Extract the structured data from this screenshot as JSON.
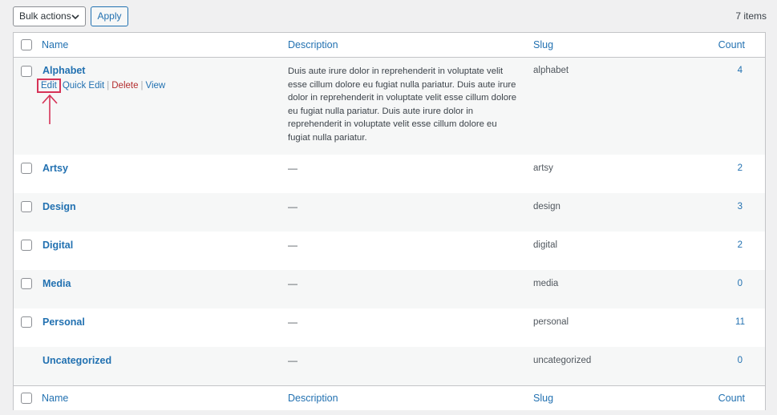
{
  "toolbar": {
    "bulk_actions_label": "Bulk actions",
    "apply_label": "Apply",
    "items_count": "7 items"
  },
  "table": {
    "columns": {
      "name": "Name",
      "description": "Description",
      "slug": "Slug",
      "count": "Count"
    },
    "rows": [
      {
        "name": "Alphabet",
        "description_lines": [
          "Duis aute irure dolor in reprehenderit in voluptate velit",
          "esse cillum dolore eu fugiat nulla pariatur. Duis aute irure",
          "dolor in reprehenderit in voluptate velit esse cillum dolore",
          "eu fugiat nulla pariatur. Duis aute irure dolor in",
          "reprehenderit in voluptate velit esse cillum dolore eu",
          "fugiat nulla pariatur."
        ],
        "slug": "alphabet",
        "count": "4",
        "row_actions": {
          "edit": "Edit",
          "quick_edit": "Quick Edit",
          "delete": "Delete",
          "view": "View",
          "separator": "|"
        }
      },
      {
        "name": "Artsy",
        "description": "—",
        "slug": "artsy",
        "count": "2"
      },
      {
        "name": "Design",
        "description": "—",
        "slug": "design",
        "count": "3"
      },
      {
        "name": "Digital",
        "description": "—",
        "slug": "digital",
        "count": "2"
      },
      {
        "name": "Media",
        "description": "—",
        "slug": "media",
        "count": "0"
      },
      {
        "name": "Personal",
        "description": "—",
        "slug": "personal",
        "count": "11"
      },
      {
        "name": "Uncategorized",
        "description": "—",
        "slug": "uncategorized",
        "count": "0"
      }
    ]
  },
  "colors": {
    "link": "#2271b1",
    "delete": "#b32d2e",
    "annotation": "#d63357",
    "alt_row": "#f6f7f7"
  },
  "icons": {
    "select_chevron": "chevron-down-icon",
    "annotation": "arrow-up-icon"
  }
}
